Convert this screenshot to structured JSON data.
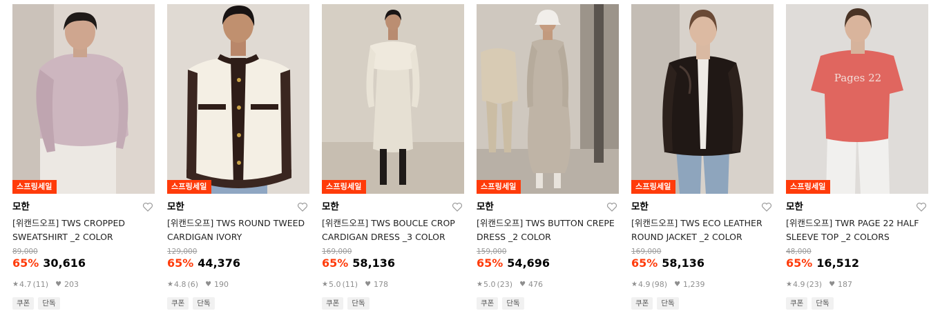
{
  "accent_color": "#ff3b0a",
  "products": [
    {
      "badge": "스프링세일",
      "brand": "모한",
      "name": "[위캔드오프] TWS CROPPED SWEATSHIRT _2 COLOR",
      "original_price": "89,000",
      "discount": "65%",
      "price": "30,616",
      "rating": "4.7",
      "review_count": "(11)",
      "likes": "203",
      "tags": [
        "쿠폰",
        "단독"
      ],
      "icon": "heart-outline-icon"
    },
    {
      "badge": "스프링세일",
      "brand": "모한",
      "name": "[위캔드오프] TWS ROUND TWEED CARDIGAN IVORY",
      "original_price": "129,000",
      "discount": "65%",
      "price": "44,376",
      "rating": "4.8",
      "review_count": "(6)",
      "likes": "190",
      "tags": [
        "쿠폰",
        "단독"
      ],
      "icon": "heart-outline-icon"
    },
    {
      "badge": "스프링세일",
      "brand": "모한",
      "name": "[위캔드오프] TWS BOUCLE CROP CARDIGAN DRESS _3 COLOR",
      "original_price": "169,000",
      "discount": "65%",
      "price": "58,136",
      "rating": "5.0",
      "review_count": "(11)",
      "likes": "178",
      "tags": [
        "쿠폰",
        "단독"
      ],
      "icon": "heart-outline-icon"
    },
    {
      "badge": "스프링세일",
      "brand": "모한",
      "name": "[위캔드오프] TWS BUTTON CREPE DRESS _2 COLOR",
      "original_price": "159,000",
      "discount": "65%",
      "price": "54,696",
      "rating": "5.0",
      "review_count": "(23)",
      "likes": "476",
      "tags": [
        "쿠폰",
        "단독"
      ],
      "icon": "heart-outline-icon"
    },
    {
      "badge": "스프링세일",
      "brand": "모한",
      "name": "[위캔드오프] TWS ECO LEATHER ROUND JACKET _2 COLOR",
      "original_price": "169,000",
      "discount": "65%",
      "price": "58,136",
      "rating": "4.9",
      "review_count": "(98)",
      "likes": "1,239",
      "tags": [
        "쿠폰",
        "단독"
      ],
      "icon": "heart-outline-icon"
    },
    {
      "badge": "스프링세일",
      "brand": "모한",
      "name": "[위캔드오프] TWR PAGE 22 HALF SLEEVE TOP _2 COLORS",
      "original_price": "48,000",
      "discount": "65%",
      "price": "16,512",
      "rating": "4.9",
      "review_count": "(23)",
      "likes": "187",
      "tags": [
        "쿠폰",
        "단독"
      ],
      "icon": "heart-outline-icon",
      "shirt_print": "Pages 22"
    }
  ]
}
